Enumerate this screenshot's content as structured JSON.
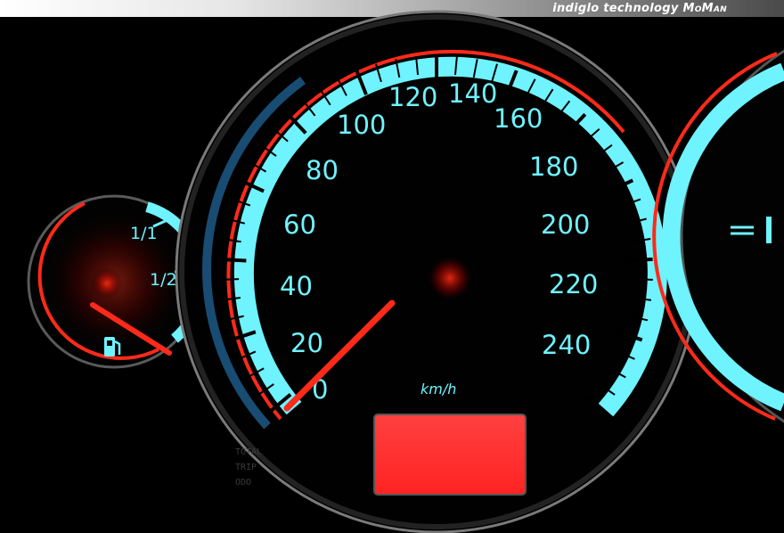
{
  "branding": {
    "text": "indiglo technology",
    "mark": "MoMan",
    "bar_gradient": [
      "#ffffff",
      "#4a4a4a"
    ]
  },
  "speedometer": {
    "unit": "km/h",
    "labels": [
      "0",
      "20",
      "40",
      "60",
      "80",
      "100",
      "120",
      "140",
      "160",
      "180",
      "200",
      "220",
      "240"
    ],
    "display": {
      "color": "#ff3030"
    },
    "needle": {
      "color": "#ff2a1a",
      "reading": 0
    }
  },
  "fuel_gauge": {
    "full_label": "1/1",
    "half_label": "1/2",
    "icon": "fuel-pump-icon",
    "needle_reading": 0
  },
  "odometer_labels": [
    "TOTAL",
    "TRIP",
    "ODO"
  ],
  "colors": {
    "backlight": "#6ff3ff",
    "accent": "#ff2020",
    "background": "#000000"
  }
}
